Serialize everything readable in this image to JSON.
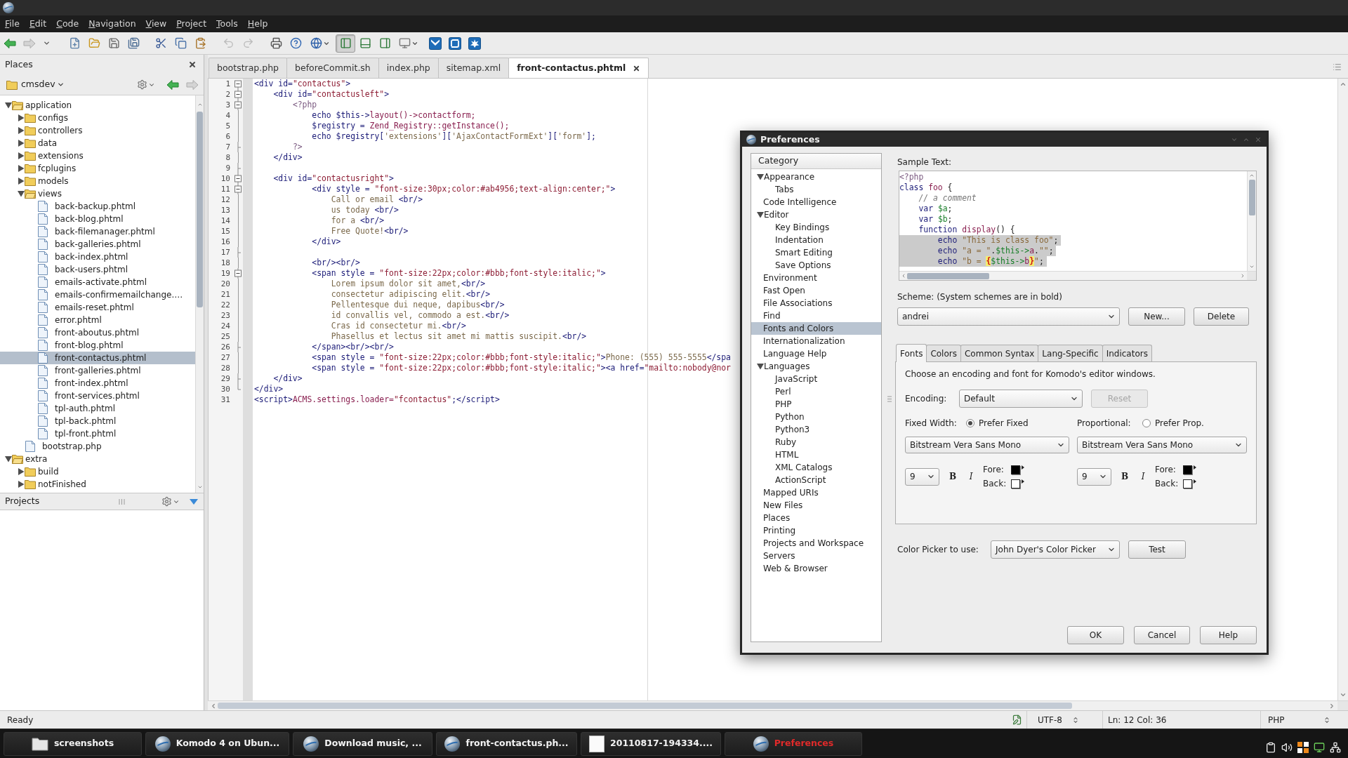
{
  "menu": [
    "File",
    "Edit",
    "Code",
    "Navigation",
    "View",
    "Project",
    "Tools",
    "Help"
  ],
  "toolbar": [
    {
      "pressed": false,
      "disabled": false
    },
    {
      "pressed": false,
      "disabled": true
    },
    {
      "pressed": false,
      "disabled": false
    },
    {
      "pressed": false,
      "disabled": false
    },
    {
      "pressed": false,
      "disabled": false
    },
    {
      "pressed": false,
      "disabled": false
    },
    {
      "pressed": false,
      "disabled": false
    },
    {
      "pressed": false,
      "disabled": false
    },
    {
      "pressed": false,
      "disabled": false
    },
    {
      "pressed": false,
      "disabled": false
    },
    {
      "pressed": false,
      "disabled": true
    },
    {
      "pressed": false,
      "disabled": true
    },
    {
      "pressed": false,
      "disabled": false
    },
    {
      "pressed": false,
      "disabled": false
    },
    {
      "pressed": false,
      "disabled": false
    },
    {
      "pressed": true,
      "disabled": false
    },
    {
      "pressed": false,
      "disabled": false
    },
    {
      "pressed": false,
      "disabled": false
    },
    {
      "pressed": false,
      "disabled": false
    },
    {
      "pressed": false,
      "disabled": false
    },
    {
      "pressed": false,
      "disabled": false
    },
    {
      "pressed": false,
      "disabled": false
    }
  ],
  "places": {
    "title": "Places",
    "root": "cmsdev",
    "nav_buttons": [
      {
        "disabled": false
      },
      {
        "disabled": true
      }
    ],
    "tree": [
      {
        "name": "application",
        "kind": "folder",
        "expanded": true,
        "selected": false,
        "children": [
          {
            "name": "configs",
            "kind": "folder",
            "expanded": false,
            "selected": false
          },
          {
            "name": "controllers",
            "kind": "folder",
            "expanded": false,
            "selected": false
          },
          {
            "name": "data",
            "kind": "folder",
            "expanded": false,
            "selected": false
          },
          {
            "name": "extensions",
            "kind": "folder",
            "expanded": false,
            "selected": false
          },
          {
            "name": "fcplugins",
            "kind": "folder",
            "expanded": false,
            "selected": false
          },
          {
            "name": "models",
            "kind": "folder",
            "expanded": false,
            "selected": false
          },
          {
            "name": "views",
            "kind": "folder",
            "expanded": true,
            "selected": false,
            "children": [
              {
                "name": "back-backup.phtml",
                "kind": "file",
                "selected": false
              },
              {
                "name": "back-blog.phtml",
                "kind": "file",
                "selected": false
              },
              {
                "name": "back-filemanager.phtml",
                "kind": "file",
                "selected": false
              },
              {
                "name": "back-galleries.phtml",
                "kind": "file",
                "selected": false
              },
              {
                "name": "back-index.phtml",
                "kind": "file",
                "selected": false
              },
              {
                "name": "back-users.phtml",
                "kind": "file",
                "selected": false
              },
              {
                "name": "emails-activate.phtml",
                "kind": "file",
                "selected": false
              },
              {
                "name": "emails-confirmemailchange.…",
                "kind": "file",
                "selected": false
              },
              {
                "name": "emails-reset.phtml",
                "kind": "file",
                "selected": false
              },
              {
                "name": "error.phtml",
                "kind": "file",
                "selected": false
              },
              {
                "name": "front-aboutus.phtml",
                "kind": "file",
                "selected": false
              },
              {
                "name": "front-blog.phtml",
                "kind": "file",
                "selected": false
              },
              {
                "name": "front-contactus.phtml",
                "kind": "file",
                "selected": true
              },
              {
                "name": "front-galleries.phtml",
                "kind": "file",
                "selected": false
              },
              {
                "name": "front-index.phtml",
                "kind": "file",
                "selected": false
              },
              {
                "name": "front-services.phtml",
                "kind": "file",
                "selected": false
              },
              {
                "name": "tpl-auth.phtml",
                "kind": "file",
                "selected": false
              },
              {
                "name": "tpl-back.phtml",
                "kind": "file",
                "selected": false
              },
              {
                "name": "tpl-front.phtml",
                "kind": "file",
                "selected": false
              }
            ]
          },
          {
            "name": "bootstrap.php",
            "kind": "file",
            "selected": false
          }
        ]
      },
      {
        "name": "extra",
        "kind": "folder",
        "expanded": true,
        "selected": false,
        "children": [
          {
            "name": "build",
            "kind": "folder",
            "expanded": false,
            "selected": false
          },
          {
            "name": "notFinished",
            "kind": "folder",
            "expanded": false,
            "selected": false
          }
        ]
      }
    ]
  },
  "projects": {
    "title": "Projects"
  },
  "editor": {
    "tabs": [
      {
        "label": "bootstrap.php",
        "selected": false
      },
      {
        "label": "beforeCommit.sh",
        "selected": false
      },
      {
        "label": "index.php",
        "selected": false
      },
      {
        "label": "sitemap.xml",
        "selected": false
      },
      {
        "label": "front-contactus.phtml",
        "selected": true
      }
    ],
    "lines": [
      {
        "number": "1",
        "kind": "start",
        "tokens": [
          {
            "kind": "markup",
            "text": "<div id="
          },
          {
            "kind": "string",
            "text": "\"contactus\""
          },
          {
            "kind": "markup",
            "text": ">"
          }
        ]
      },
      {
        "number": "2",
        "kind": "start",
        "tokens": [
          {
            "kind": "markup",
            "text": "    <div id="
          },
          {
            "kind": "string",
            "text": "\"contactusleft\""
          },
          {
            "kind": "markup",
            "text": ">"
          }
        ]
      },
      {
        "number": "3",
        "kind": "start",
        "tokens": [
          {
            "kind": "php",
            "text": "        <?php"
          }
        ]
      },
      {
        "number": "4",
        "kind": "through",
        "tokens": [
          {
            "kind": "markup",
            "text": "            echo $this->"
          },
          {
            "kind": "call",
            "text": "layout()->contactform;"
          }
        ]
      },
      {
        "number": "5",
        "kind": "through",
        "tokens": [
          {
            "kind": "markup",
            "text": "            $registry = "
          },
          {
            "kind": "call",
            "text": "Zend_Registry::getInstance();"
          }
        ]
      },
      {
        "number": "6",
        "kind": "through",
        "tokens": [
          {
            "kind": "markup",
            "text": "            echo $registry["
          },
          {
            "kind": "quote",
            "text": "'extensions'"
          },
          {
            "kind": "markup",
            "text": "]["
          },
          {
            "kind": "quote",
            "text": "'AjaxContactFormExt'"
          },
          {
            "kind": "markup",
            "text": "]["
          },
          {
            "kind": "quote",
            "text": "'form'"
          },
          {
            "kind": "markup",
            "text": "];"
          }
        ]
      },
      {
        "number": "7",
        "kind": "end",
        "tokens": [
          {
            "kind": "php",
            "text": "        ?>"
          }
        ]
      },
      {
        "number": "8",
        "kind": "through",
        "tokens": [
          {
            "kind": "markup",
            "text": "    </div>"
          }
        ]
      },
      {
        "number": "9",
        "kind": "end"
      },
      {
        "number": "10",
        "kind": "start",
        "tokens": [
          {
            "kind": "markup",
            "text": "    <div id="
          },
          {
            "kind": "string",
            "text": "\"contactusright\""
          },
          {
            "kind": "markup",
            "text": ">"
          }
        ]
      },
      {
        "number": "11",
        "kind": "start",
        "tokens": [
          {
            "kind": "markup",
            "text": "            <div style = "
          },
          {
            "kind": "string",
            "text": "\"font-size:30px;color:#ab4956;text-align:center;\""
          },
          {
            "kind": "markup",
            "text": ">"
          }
        ]
      },
      {
        "number": "12",
        "kind": "through",
        "tokens": [
          {
            "kind": "text",
            "text": "                Call or email "
          },
          {
            "kind": "markup",
            "text": "<br/>"
          }
        ]
      },
      {
        "number": "13",
        "kind": "through",
        "tokens": [
          {
            "kind": "text",
            "text": "                us today "
          },
          {
            "kind": "markup",
            "text": "<br/>"
          }
        ]
      },
      {
        "number": "14",
        "kind": "through",
        "tokens": [
          {
            "kind": "text",
            "text": "                for a "
          },
          {
            "kind": "markup",
            "text": "<br/>"
          }
        ]
      },
      {
        "number": "15",
        "kind": "through",
        "tokens": [
          {
            "kind": "text",
            "text": "                Free Quote!"
          },
          {
            "kind": "markup",
            "text": "<br/>"
          }
        ]
      },
      {
        "number": "16",
        "kind": "through",
        "tokens": [
          {
            "kind": "markup",
            "text": "            </div>"
          }
        ]
      },
      {
        "number": "17",
        "kind": "end"
      },
      {
        "number": "18",
        "kind": "through",
        "tokens": [
          {
            "kind": "markup",
            "text": "            <br/><br/>"
          }
        ]
      },
      {
        "number": "19",
        "kind": "start",
        "tokens": [
          {
            "kind": "markup",
            "text": "            <span style = "
          },
          {
            "kind": "string",
            "text": "\"font-size:22px;color:#bbb;font-style:italic;\""
          },
          {
            "kind": "markup",
            "text": ">"
          }
        ]
      },
      {
        "number": "20",
        "kind": "through",
        "tokens": [
          {
            "kind": "text",
            "text": "                Lorem ipsum dolor sit amet,"
          },
          {
            "kind": "markup",
            "text": "<br/>"
          }
        ]
      },
      {
        "number": "21",
        "kind": "through",
        "tokens": [
          {
            "kind": "text",
            "text": "                consectetur adipiscing elit."
          },
          {
            "kind": "markup",
            "text": "<br/>"
          }
        ]
      },
      {
        "number": "22",
        "kind": "through",
        "tokens": [
          {
            "kind": "text",
            "text": "                Pellentesque dui neque, dapibus"
          },
          {
            "kind": "markup",
            "text": "<br/>"
          }
        ]
      },
      {
        "number": "23",
        "kind": "through",
        "tokens": [
          {
            "kind": "text",
            "text": "                id convallis vel, commodo a est."
          },
          {
            "kind": "markup",
            "text": "<br/>"
          }
        ]
      },
      {
        "number": "24",
        "kind": "through",
        "tokens": [
          {
            "kind": "text",
            "text": "                Cras id consectetur mi."
          },
          {
            "kind": "markup",
            "text": "<br/>"
          }
        ]
      },
      {
        "number": "25",
        "kind": "through",
        "tokens": [
          {
            "kind": "text",
            "text": "                Phasellus et lectus sit amet mi mattis suscipit."
          },
          {
            "kind": "markup",
            "text": "<br/>"
          }
        ]
      },
      {
        "number": "26",
        "kind": "end",
        "tokens": [
          {
            "kind": "markup",
            "text": "            </span><br/><br/>"
          }
        ]
      },
      {
        "number": "27",
        "kind": "through",
        "tokens": [
          {
            "kind": "markup",
            "text": "            <span style = "
          },
          {
            "kind": "string",
            "text": "\"font-size:22px;color:#bbb;font-style:italic;\""
          },
          {
            "kind": "markup",
            "text": ">"
          },
          {
            "kind": "text",
            "text": "Phone: (555) 555-5555"
          },
          {
            "kind": "markup",
            "text": "</spa"
          }
        ]
      },
      {
        "number": "28",
        "kind": "through",
        "tokens": [
          {
            "kind": "markup",
            "text": "            <span style = "
          },
          {
            "kind": "string",
            "text": "\"font-size:22px;color:#bbb;font-style:italic;\""
          },
          {
            "kind": "markup",
            "text": "><a href="
          },
          {
            "kind": "string",
            "text": "\"mailto:nobody@nor"
          }
        ]
      },
      {
        "number": "29",
        "kind": "end",
        "tokens": [
          {
            "kind": "markup",
            "text": "    </div>"
          }
        ]
      },
      {
        "number": "30",
        "kind": "last",
        "tokens": [
          {
            "kind": "markup",
            "text": "</div>"
          }
        ]
      },
      {
        "number": "31",
        "tokens": [
          {
            "kind": "markup",
            "text": "<script>"
          },
          {
            "kind": "call",
            "text": "ACMS.settings.loader="
          },
          {
            "kind": "string",
            "text": "\"fcontactus\""
          },
          {
            "kind": "markup",
            "text": ";</script>"
          }
        ]
      }
    ]
  },
  "preferences": {
    "title": "Preferences",
    "category_header": "Category",
    "categories": [
      {
        "label": "Appearance",
        "expanded": true,
        "selected": false,
        "children": [
          {
            "label": "Tabs",
            "selected": false
          }
        ]
      },
      {
        "label": "Code Intelligence",
        "selected": false
      },
      {
        "label": "Editor",
        "expanded": true,
        "selected": false,
        "children": [
          {
            "label": "Key Bindings",
            "selected": false
          },
          {
            "label": "Indentation",
            "selected": false
          },
          {
            "label": "Smart Editing",
            "selected": false
          },
          {
            "label": "Save Options",
            "selected": false
          }
        ]
      },
      {
        "label": "Environment",
        "selected": false
      },
      {
        "label": "Fast Open",
        "selected": false
      },
      {
        "label": "File Associations",
        "selected": false
      },
      {
        "label": "Find",
        "selected": false
      },
      {
        "label": "Fonts and Colors",
        "selected": true
      },
      {
        "label": "Internationalization",
        "selected": false
      },
      {
        "label": "Language Help",
        "selected": false
      },
      {
        "label": "Languages",
        "expanded": true,
        "selected": false,
        "children": [
          {
            "label": "JavaScript",
            "selected": false
          },
          {
            "label": "Perl",
            "selected": false
          },
          {
            "label": "PHP",
            "selected": false
          },
          {
            "label": "Python",
            "selected": false
          },
          {
            "label": "Python3",
            "selected": false
          },
          {
            "label": "Ruby",
            "selected": false
          },
          {
            "label": "HTML",
            "selected": false
          },
          {
            "label": "XML Catalogs",
            "selected": false
          },
          {
            "label": "ActionScript",
            "selected": false
          }
        ]
      },
      {
        "label": "Mapped URIs",
        "selected": false
      },
      {
        "label": "New Files",
        "selected": false
      },
      {
        "label": "Places",
        "selected": false
      },
      {
        "label": "Printing",
        "selected": false
      },
      {
        "label": "Projects and Workspace",
        "selected": false
      },
      {
        "label": "Servers",
        "selected": false
      },
      {
        "label": "Web & Browser",
        "selected": false
      }
    ],
    "sample_label": "Sample Text:",
    "sample_lines": [
      {
        "selected": false,
        "tokens": [
          {
            "kind": "php",
            "text": "<?php"
          }
        ]
      },
      {
        "selected": false,
        "tokens": [
          {
            "kind": "keyword",
            "text": "class "
          },
          {
            "kind": "name",
            "text": "foo"
          },
          {
            "kind": "plain",
            "text": " {"
          }
        ]
      },
      {
        "selected": false,
        "tokens": [
          {
            "kind": "comment",
            "text": "    // a comment"
          }
        ]
      },
      {
        "selected": false,
        "tokens": [
          {
            "kind": "keyword",
            "text": "    var "
          },
          {
            "kind": "variable",
            "text": "$a"
          },
          {
            "kind": "plain",
            "text": ";"
          }
        ]
      },
      {
        "selected": false,
        "tokens": [
          {
            "kind": "keyword",
            "text": "    var "
          },
          {
            "kind": "variable",
            "text": "$b"
          },
          {
            "kind": "plain",
            "text": ";"
          }
        ]
      },
      {
        "selected": false,
        "tokens": [
          {
            "kind": "keyword",
            "text": "    function "
          },
          {
            "kind": "name",
            "text": "display"
          },
          {
            "kind": "plain",
            "text": "() {"
          }
        ]
      },
      {
        "selected": true,
        "tokens": [
          {
            "kind": "keyword",
            "text": "        echo "
          },
          {
            "kind": "string",
            "text": "\"This is class foo\""
          },
          {
            "kind": "plain",
            "text": ";"
          }
        ]
      },
      {
        "selected": true,
        "tokens": [
          {
            "kind": "keyword",
            "text": "        echo "
          },
          {
            "kind": "string",
            "text": "\"a = \""
          },
          {
            "kind": "plain",
            "text": "."
          },
          {
            "kind": "variable",
            "text": "$this->"
          },
          {
            "kind": "name",
            "text": "a"
          },
          {
            "kind": "plain",
            "text": "."
          },
          {
            "kind": "string",
            "text": "\"\""
          },
          {
            "kind": "plain",
            "text": ";"
          }
        ]
      },
      {
        "selected": true,
        "tokens": [
          {
            "kind": "keyword",
            "text": "        echo "
          },
          {
            "kind": "string",
            "text": "\"b = "
          },
          {
            "kind": "brace",
            "text": "{"
          },
          {
            "kind": "variable",
            "text": "$this->"
          },
          {
            "kind": "name",
            "text": "b"
          },
          {
            "kind": "brace",
            "text": "}"
          },
          {
            "kind": "string",
            "text": "\""
          },
          {
            "kind": "plain",
            "text": ";"
          }
        ]
      }
    ],
    "scheme": {
      "label": "Scheme: (System schemes are in bold)",
      "value": "andrei",
      "buttons": [
        "New...",
        "Delete"
      ]
    },
    "tabs": [
      {
        "label": "Fonts",
        "selected": true
      },
      {
        "label": "Colors",
        "selected": false
      },
      {
        "label": "Common Syntax",
        "selected": false
      },
      {
        "label": "Lang-Specific",
        "selected": false
      },
      {
        "label": "Indicators",
        "selected": false
      }
    ],
    "fonts": {
      "intro": "Choose an encoding and font for Komodo's editor windows.",
      "encoding_label": "Encoding:",
      "encoding": "Default",
      "reset": {
        "label": "Reset",
        "disabled": true
      },
      "groups": [
        {
          "label": "Fixed Width:",
          "option": "Prefer Fixed",
          "selected": true,
          "font": "Bitstream Vera Sans Mono",
          "size": "9",
          "bold": "B",
          "italic": "I",
          "swatches": [
            {
              "label": "Fore:",
              "color": "#000000"
            },
            {
              "label": "Back:",
              "color": "#ffffff"
            }
          ]
        },
        {
          "label": "Proportional:",
          "option": "Prefer Prop.",
          "selected": false,
          "font": "Bitstream Vera Sans Mono",
          "size": "9",
          "bold": "B",
          "italic": "I",
          "swatches": [
            {
              "label": "Fore:",
              "color": "#000000"
            },
            {
              "label": "Back:",
              "color": "#ffffff"
            }
          ]
        }
      ]
    },
    "color_picker": {
      "label": "Color Picker to use:",
      "value": "John Dyer's Color Picker",
      "button": "Test"
    },
    "buttons": [
      "OK",
      "Cancel",
      "Help"
    ]
  },
  "status_bar": {
    "message": "Ready",
    "encoding": "UTF-8",
    "position": "Ln: 12 Col: 36",
    "language": "PHP"
  },
  "taskbar": [
    {
      "label": "screenshots",
      "selected": false
    },
    {
      "label": "Komodo 4 on Ubun...",
      "selected": false
    },
    {
      "label": "Download music, ...",
      "selected": false
    },
    {
      "label": "front-contactus.ph...",
      "selected": false
    },
    {
      "label": "20110817-194334....",
      "selected": false
    },
    {
      "label": "Preferences",
      "selected": true
    }
  ]
}
